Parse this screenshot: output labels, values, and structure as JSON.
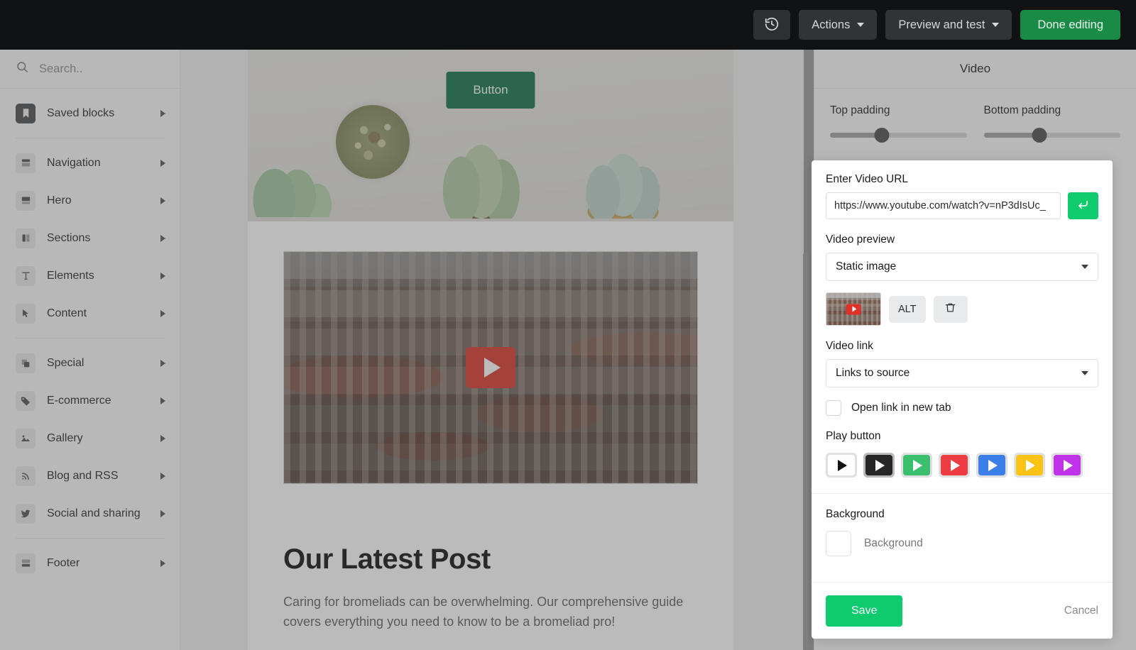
{
  "topbar": {
    "history_icon": "history-clock-icon",
    "actions_label": "Actions",
    "preview_label": "Preview and test",
    "done_label": "Done editing",
    "bg": "#111213",
    "done_bg": "#1a8a47"
  },
  "sidebar": {
    "search_placeholder": "Search..",
    "search_icon": "search-icon",
    "groups": [
      {
        "items": [
          {
            "label": "Saved blocks",
            "icon": "bookmark-icon",
            "dark": true
          }
        ]
      },
      {
        "items": [
          {
            "label": "Navigation",
            "icon": "navigation-block-icon",
            "dark": false
          },
          {
            "label": "Hero",
            "icon": "hero-block-icon",
            "dark": false
          },
          {
            "label": "Sections",
            "icon": "columns-block-icon",
            "dark": false
          },
          {
            "label": "Elements",
            "icon": "text-element-icon",
            "dark": false
          },
          {
            "label": "Content",
            "icon": "cursor-icon",
            "dark": false
          }
        ]
      },
      {
        "items": [
          {
            "label": "Special",
            "icon": "layers-icon",
            "dark": false
          },
          {
            "label": "E-commerce",
            "icon": "tag-icon",
            "dark": false
          },
          {
            "label": "Gallery",
            "icon": "image-icon",
            "dark": false
          },
          {
            "label": "Blog and RSS",
            "icon": "rss-icon",
            "dark": false
          },
          {
            "label": "Social and sharing",
            "icon": "twitter-bird-icon",
            "dark": false
          }
        ]
      },
      {
        "items": [
          {
            "label": "Footer",
            "icon": "footer-block-icon",
            "dark": false
          }
        ]
      }
    ]
  },
  "canvas": {
    "hero_button_label": "Button",
    "hero_button_color": "#10714b",
    "video_play_icon": "play-button-icon",
    "post_title": "Our Latest Post",
    "post_body": "Caring for bromeliads can be overwhelming. Our comprehensive guide covers everything you need to know to be a bromeliad pro!"
  },
  "panel": {
    "title": "Video",
    "top_padding_label": "Top padding",
    "bottom_padding_label": "Bottom padding",
    "top_padding_value": 38,
    "bottom_padding_value": 41
  },
  "modal": {
    "url_label": "Enter Video URL",
    "url_value": "https://www.youtube.com/watch?v=nP3dIsUc_",
    "url_submit_icon": "enter-arrow-icon",
    "preview_label": "Video preview",
    "preview_value": "Static image",
    "alt_label": "ALT",
    "delete_icon": "trash-icon",
    "thumbnail_name": "video-thumbnail",
    "link_label": "Video link",
    "link_value": "Links to source",
    "newtab_label": "Open link in new tab",
    "newtab_checked": false,
    "play_button_label": "Play button",
    "play_buttons": [
      {
        "name": "play-style-white",
        "bg": "#ffffff",
        "tri": "dark",
        "selected": false
      },
      {
        "name": "play-style-black",
        "bg": "#262626",
        "tri": "light",
        "selected": true
      },
      {
        "name": "play-style-green",
        "bg": "#3ac06c",
        "tri": "light",
        "selected": false
      },
      {
        "name": "play-style-red",
        "bg": "#ef3b42",
        "tri": "light",
        "selected": false
      },
      {
        "name": "play-style-blue",
        "bg": "#3b7ee8",
        "tri": "light",
        "selected": false
      },
      {
        "name": "play-style-yellow",
        "bg": "#fbc314",
        "tri": "light",
        "selected": false
      },
      {
        "name": "play-style-purple",
        "bg": "#c033e8",
        "tri": "light",
        "selected": false
      }
    ],
    "background_label": "Background",
    "background_swatch_label": "Background",
    "background_color": "#ffffff",
    "save_label": "Save",
    "save_color": "#0ecb6e",
    "cancel_label": "Cancel"
  }
}
